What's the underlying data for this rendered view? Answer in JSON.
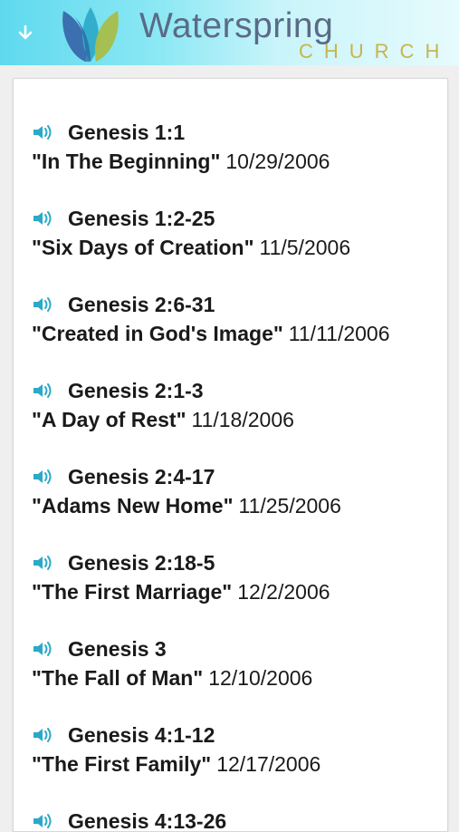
{
  "header": {
    "brand_name": "Waterspring",
    "brand_sub": "CHURCH",
    "colors": {
      "leaf_blue": "#3b6fb0",
      "leaf_teal": "#2aa9c8",
      "leaf_green": "#a8bd4a",
      "brand_text": "#5a6b86",
      "brand_sub": "#c9b44a"
    }
  },
  "sermons": [
    {
      "reference": "Genesis 1:1",
      "title": "\"In The Beginning\"",
      "date": "10/29/2006"
    },
    {
      "reference": "Genesis 1:2-25",
      "title": "\"Six Days of Creation\"",
      "date": "11/5/2006"
    },
    {
      "reference": "Genesis 2:6-31",
      "title": "\"Created in God's Image\"",
      "date": "11/11/2006"
    },
    {
      "reference": "Genesis 2:1-3",
      "title": "\"A Day of Rest\"",
      "date": "11/18/2006"
    },
    {
      "reference": "Genesis 2:4-17",
      "title": "\"Adams New Home\"",
      "date": "11/25/2006"
    },
    {
      "reference": "Genesis 2:18-5",
      "title": "\"The First Marriage\"",
      "date": "12/2/2006"
    },
    {
      "reference": "Genesis 3",
      "title": "\"The Fall of Man\"",
      "date": "12/10/2006"
    },
    {
      "reference": "Genesis 4:1-12",
      "title": "\"The First Family\"",
      "date": "12/17/2006"
    },
    {
      "reference": "Genesis 4:13-26",
      "title": "",
      "date": ""
    }
  ],
  "icons": {
    "menu": "down-arrow-icon",
    "audio": "speaker-icon"
  }
}
